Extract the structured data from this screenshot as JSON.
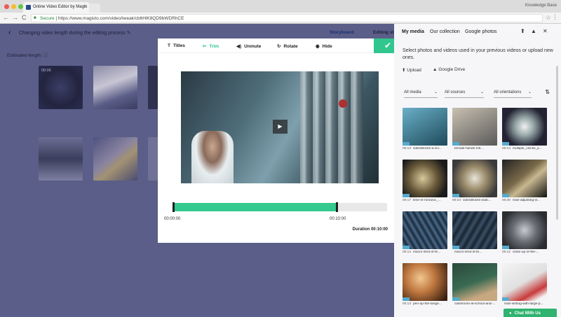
{
  "browser": {
    "tab_title": "Online Video Editor by Magis",
    "tab_close": "×",
    "profile_name": "Knowledge Base",
    "secure_label": "Secure",
    "url": "https://www.magisto.com/video/tweak/cb6HlK8QD9bWDRhCE",
    "nav_back": "←",
    "nav_forward": "→",
    "nav_reload": "C",
    "star": "☆",
    "menu": "⋮"
  },
  "app": {
    "back_icon": "‹",
    "project_title": "Changing video length during the editing process ✎",
    "tab_storyboard": "Storyboard",
    "tab_editing": "Editing st",
    "estimated_label": "Estimated length: ⓘ",
    "first_thumb_time": "00:06"
  },
  "editor": {
    "tools": [
      {
        "icon": "T",
        "label": "Titles"
      },
      {
        "icon": "✂",
        "label": "Trim"
      },
      {
        "icon": "◀)",
        "label": "Unmute"
      },
      {
        "icon": "↻",
        "label": "Rotate"
      },
      {
        "icon": "◉",
        "label": "Hide"
      }
    ],
    "confirm": "✔",
    "play": "▶",
    "trim_start": "00:00:00",
    "trim_end": "00:10:00",
    "duration": "Duration 00:10:00",
    "trim_range_fraction": [
      0.0,
      0.77
    ]
  },
  "panel": {
    "tabs": [
      "My media",
      "Our collection",
      "Google photos"
    ],
    "icons": [
      "⬆",
      "▲",
      "✕"
    ],
    "description": "Select photos and videos used in your previous videos or upload new ones.",
    "upload_label": "Upload",
    "upload_icon": "⬆",
    "drive_label": "Google Drive",
    "drive_icon": "▲",
    "filters": [
      "All media",
      "All sources",
      "All orientations"
    ],
    "filter_chev": "⌄",
    "sort_icon": "⇅",
    "media": [
      {
        "time": "00:13",
        "name": "videoblocks-a-sci..."
      },
      {
        "time": "",
        "name": "female-hands-roll..."
      },
      {
        "time": "00:14",
        "name": "multiple_clocks_p..."
      },
      {
        "time": "00:17",
        "name": "time-in-romanic_..."
      },
      {
        "time": "00:24",
        "name": "videoblocks-watc..."
      },
      {
        "time": "00:20",
        "name": "man-adjusting-w..."
      },
      {
        "time": "00:14",
        "name": "macro-shot-of-th..."
      },
      {
        "time": "",
        "name": "macro-shot-of-th..."
      },
      {
        "time": "00:12",
        "name": "close-up-of-the-..."
      },
      {
        "time": "00:13",
        "name": "pen-up-the-tange..."
      },
      {
        "time": "",
        "name": "classroom-at-school-and-..."
      },
      {
        "time": "",
        "name": "man-writing-with-large-p..."
      }
    ],
    "chat_label": "Chat With Us",
    "chat_icon": "●"
  },
  "colors": {
    "accent": "#32c68f",
    "overlay": "#5b5e88",
    "panel_bg": "#f6f6f9"
  }
}
